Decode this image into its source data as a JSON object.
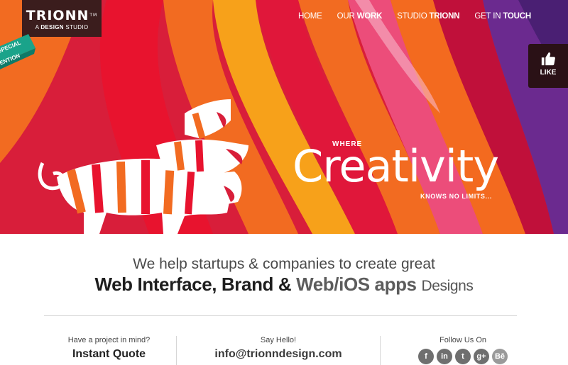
{
  "logo": {
    "name": "TRIONN",
    "tm": "TM",
    "tagline_prefix": "A",
    "tagline_bold": "DESIGN",
    "tagline_suffix": "STUDIO"
  },
  "nav": {
    "home": "HOME",
    "work_a": "OUR",
    "work_b": "WORK",
    "studio_a": "STUDIO",
    "studio_b": "TRIONN",
    "touch_a": "GET IN",
    "touch_b": "TOUCH"
  },
  "ribbon": {
    "line1": "SPECIAL",
    "line2": "ENTION"
  },
  "like": {
    "label": "LIKE",
    "icon": "thumbs-up-icon"
  },
  "hero": {
    "where": "WHERE",
    "word": "Creativity",
    "limits": "KNOWS NO LIMITS..."
  },
  "intro": {
    "line1": "We help startups & companies to create great",
    "web_interface": "Web Interface,",
    "brand": "Brand &",
    "apps": "Web/iOS apps",
    "designs": "Designs"
  },
  "columns": {
    "project_label": "Have a project in mind?",
    "project_cta": "Instant Quote",
    "hello_label": "Say Hello!",
    "email": "info@trionndesign.com",
    "follow_label": "Follow Us On"
  },
  "social": [
    {
      "glyph": "f",
      "icon": "facebook-icon"
    },
    {
      "glyph": "in",
      "icon": "linkedin-icon"
    },
    {
      "glyph": "t",
      "icon": "twitter-icon"
    },
    {
      "glyph": "g+",
      "icon": "google-plus-icon"
    },
    {
      "glyph": "Bē",
      "icon": "behance-icon"
    }
  ],
  "colors": {
    "hero_red": "#d81e3a",
    "orange": "#f26b21",
    "purple": "#6b2a8f",
    "logo_bg": "#3b1d1d",
    "ribbon_green": "#1aa38a"
  }
}
